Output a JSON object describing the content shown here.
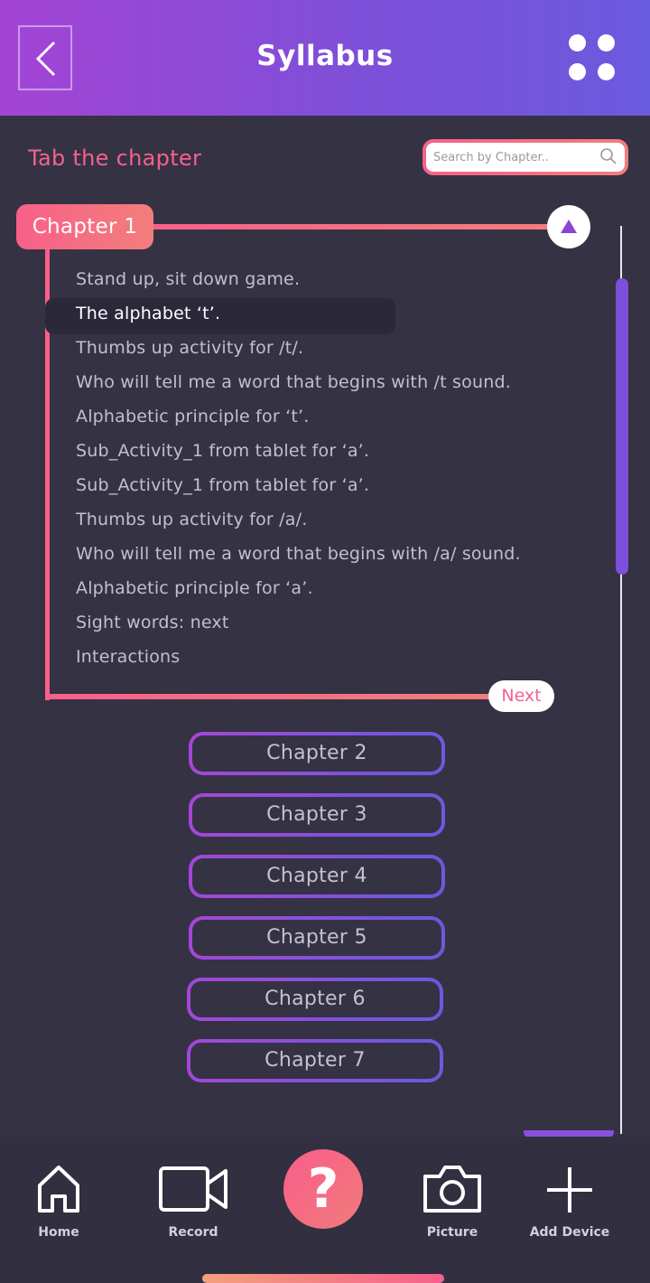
{
  "header": {
    "title": "Syllabus",
    "back_icon": "chevron-left-icon",
    "menu_icon": "grid-dots-icon"
  },
  "subheader": {
    "label": "Tab the chapter",
    "search_placeholder": "Search by Chapter.."
  },
  "chapter_open": {
    "title": "Chapter 1",
    "lessons": [
      "Stand up, sit down game.",
      "The alphabet ‘t’.",
      "Thumbs up activity for /t/.",
      "Who will tell me a word that begins with /t sound.",
      "Alphabetic principle for ‘t’.",
      "Sub_Activity_1 from tablet for ‘a’.",
      "Sub_Activity_1 from tablet for ‘a’.",
      "Thumbs up activity for /a/.",
      "Who will tell me a word that begins with /a/ sound.",
      "Alphabetic principle for ‘a’.",
      "Sight words: next",
      "Interactions"
    ],
    "active_lesson_index": 1,
    "next_label": "Next"
  },
  "chapters": [
    "Chapter 2",
    "Chapter 3",
    "Chapter 4",
    "Chapter 5",
    "Chapter 6",
    "Chapter 7"
  ],
  "bottom_nav": {
    "items": [
      {
        "label": "Home",
        "icon": "home-icon"
      },
      {
        "label": "Record",
        "icon": "video-camera-icon"
      },
      {
        "label": "",
        "icon": "help-icon",
        "glyph": "?"
      },
      {
        "label": "Picture",
        "icon": "camera-icon"
      },
      {
        "label": "Add Device",
        "icon": "plus-icon"
      }
    ]
  },
  "colors": {
    "accent_pink": "#f5618e",
    "accent_purple": "#7c4fdc",
    "background": "#353244"
  }
}
